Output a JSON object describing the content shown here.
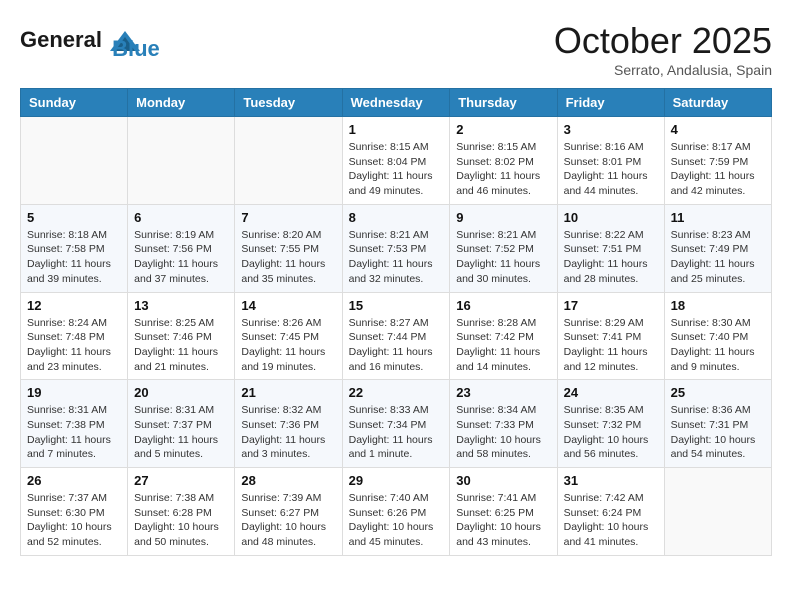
{
  "header": {
    "logo_line1": "General",
    "logo_line2": "Blue",
    "month": "October 2025",
    "location": "Serrato, Andalusia, Spain"
  },
  "days_of_week": [
    "Sunday",
    "Monday",
    "Tuesday",
    "Wednesday",
    "Thursday",
    "Friday",
    "Saturday"
  ],
  "weeks": [
    [
      {
        "day": "",
        "sunrise": "",
        "sunset": "",
        "daylight": ""
      },
      {
        "day": "",
        "sunrise": "",
        "sunset": "",
        "daylight": ""
      },
      {
        "day": "",
        "sunrise": "",
        "sunset": "",
        "daylight": ""
      },
      {
        "day": "1",
        "sunrise": "Sunrise: 8:15 AM",
        "sunset": "Sunset: 8:04 PM",
        "daylight": "Daylight: 11 hours and 49 minutes."
      },
      {
        "day": "2",
        "sunrise": "Sunrise: 8:15 AM",
        "sunset": "Sunset: 8:02 PM",
        "daylight": "Daylight: 11 hours and 46 minutes."
      },
      {
        "day": "3",
        "sunrise": "Sunrise: 8:16 AM",
        "sunset": "Sunset: 8:01 PM",
        "daylight": "Daylight: 11 hours and 44 minutes."
      },
      {
        "day": "4",
        "sunrise": "Sunrise: 8:17 AM",
        "sunset": "Sunset: 7:59 PM",
        "daylight": "Daylight: 11 hours and 42 minutes."
      }
    ],
    [
      {
        "day": "5",
        "sunrise": "Sunrise: 8:18 AM",
        "sunset": "Sunset: 7:58 PM",
        "daylight": "Daylight: 11 hours and 39 minutes."
      },
      {
        "day": "6",
        "sunrise": "Sunrise: 8:19 AM",
        "sunset": "Sunset: 7:56 PM",
        "daylight": "Daylight: 11 hours and 37 minutes."
      },
      {
        "day": "7",
        "sunrise": "Sunrise: 8:20 AM",
        "sunset": "Sunset: 7:55 PM",
        "daylight": "Daylight: 11 hours and 35 minutes."
      },
      {
        "day": "8",
        "sunrise": "Sunrise: 8:21 AM",
        "sunset": "Sunset: 7:53 PM",
        "daylight": "Daylight: 11 hours and 32 minutes."
      },
      {
        "day": "9",
        "sunrise": "Sunrise: 8:21 AM",
        "sunset": "Sunset: 7:52 PM",
        "daylight": "Daylight: 11 hours and 30 minutes."
      },
      {
        "day": "10",
        "sunrise": "Sunrise: 8:22 AM",
        "sunset": "Sunset: 7:51 PM",
        "daylight": "Daylight: 11 hours and 28 minutes."
      },
      {
        "day": "11",
        "sunrise": "Sunrise: 8:23 AM",
        "sunset": "Sunset: 7:49 PM",
        "daylight": "Daylight: 11 hours and 25 minutes."
      }
    ],
    [
      {
        "day": "12",
        "sunrise": "Sunrise: 8:24 AM",
        "sunset": "Sunset: 7:48 PM",
        "daylight": "Daylight: 11 hours and 23 minutes."
      },
      {
        "day": "13",
        "sunrise": "Sunrise: 8:25 AM",
        "sunset": "Sunset: 7:46 PM",
        "daylight": "Daylight: 11 hours and 21 minutes."
      },
      {
        "day": "14",
        "sunrise": "Sunrise: 8:26 AM",
        "sunset": "Sunset: 7:45 PM",
        "daylight": "Daylight: 11 hours and 19 minutes."
      },
      {
        "day": "15",
        "sunrise": "Sunrise: 8:27 AM",
        "sunset": "Sunset: 7:44 PM",
        "daylight": "Daylight: 11 hours and 16 minutes."
      },
      {
        "day": "16",
        "sunrise": "Sunrise: 8:28 AM",
        "sunset": "Sunset: 7:42 PM",
        "daylight": "Daylight: 11 hours and 14 minutes."
      },
      {
        "day": "17",
        "sunrise": "Sunrise: 8:29 AM",
        "sunset": "Sunset: 7:41 PM",
        "daylight": "Daylight: 11 hours and 12 minutes."
      },
      {
        "day": "18",
        "sunrise": "Sunrise: 8:30 AM",
        "sunset": "Sunset: 7:40 PM",
        "daylight": "Daylight: 11 hours and 9 minutes."
      }
    ],
    [
      {
        "day": "19",
        "sunrise": "Sunrise: 8:31 AM",
        "sunset": "Sunset: 7:38 PM",
        "daylight": "Daylight: 11 hours and 7 minutes."
      },
      {
        "day": "20",
        "sunrise": "Sunrise: 8:31 AM",
        "sunset": "Sunset: 7:37 PM",
        "daylight": "Daylight: 11 hours and 5 minutes."
      },
      {
        "day": "21",
        "sunrise": "Sunrise: 8:32 AM",
        "sunset": "Sunset: 7:36 PM",
        "daylight": "Daylight: 11 hours and 3 minutes."
      },
      {
        "day": "22",
        "sunrise": "Sunrise: 8:33 AM",
        "sunset": "Sunset: 7:34 PM",
        "daylight": "Daylight: 11 hours and 1 minute."
      },
      {
        "day": "23",
        "sunrise": "Sunrise: 8:34 AM",
        "sunset": "Sunset: 7:33 PM",
        "daylight": "Daylight: 10 hours and 58 minutes."
      },
      {
        "day": "24",
        "sunrise": "Sunrise: 8:35 AM",
        "sunset": "Sunset: 7:32 PM",
        "daylight": "Daylight: 10 hours and 56 minutes."
      },
      {
        "day": "25",
        "sunrise": "Sunrise: 8:36 AM",
        "sunset": "Sunset: 7:31 PM",
        "daylight": "Daylight: 10 hours and 54 minutes."
      }
    ],
    [
      {
        "day": "26",
        "sunrise": "Sunrise: 7:37 AM",
        "sunset": "Sunset: 6:30 PM",
        "daylight": "Daylight: 10 hours and 52 minutes."
      },
      {
        "day": "27",
        "sunrise": "Sunrise: 7:38 AM",
        "sunset": "Sunset: 6:28 PM",
        "daylight": "Daylight: 10 hours and 50 minutes."
      },
      {
        "day": "28",
        "sunrise": "Sunrise: 7:39 AM",
        "sunset": "Sunset: 6:27 PM",
        "daylight": "Daylight: 10 hours and 48 minutes."
      },
      {
        "day": "29",
        "sunrise": "Sunrise: 7:40 AM",
        "sunset": "Sunset: 6:26 PM",
        "daylight": "Daylight: 10 hours and 45 minutes."
      },
      {
        "day": "30",
        "sunrise": "Sunrise: 7:41 AM",
        "sunset": "Sunset: 6:25 PM",
        "daylight": "Daylight: 10 hours and 43 minutes."
      },
      {
        "day": "31",
        "sunrise": "Sunrise: 7:42 AM",
        "sunset": "Sunset: 6:24 PM",
        "daylight": "Daylight: 10 hours and 41 minutes."
      },
      {
        "day": "",
        "sunrise": "",
        "sunset": "",
        "daylight": ""
      }
    ]
  ]
}
